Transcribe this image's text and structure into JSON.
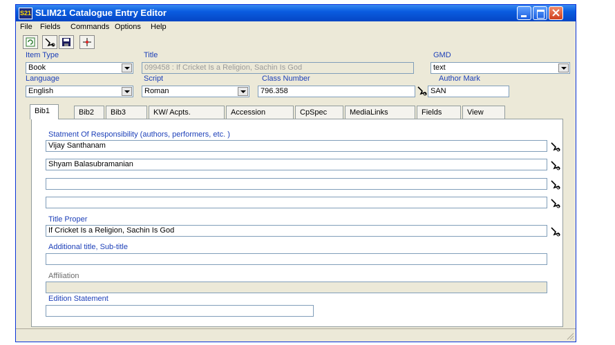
{
  "window": {
    "title": "SLIM21 Catalogue Entry Editor",
    "icon_text": "S21",
    "colors": {
      "titlebar": "#0a5ce0",
      "label": "#1c3fb8",
      "close_button": "#d0401e"
    }
  },
  "menubar": {
    "items": [
      "File",
      "Fields",
      "Commands",
      "Options",
      "Help"
    ]
  },
  "toolbar": {
    "icons": [
      "refresh-icon",
      "lookup-icon",
      "save-icon",
      "move-icon"
    ]
  },
  "header_fields": {
    "item_type": {
      "label": "Item Type",
      "value": "Book"
    },
    "title": {
      "label": "Title",
      "value": "099458 : If Cricket Is a Religion, Sachin Is God"
    },
    "gmd": {
      "label": "GMD",
      "value": "text"
    },
    "language": {
      "label": "Language",
      "value": "English"
    },
    "script": {
      "label": "Script",
      "value": "Roman"
    },
    "class_number": {
      "label": "Class Number",
      "value": "796.358"
    },
    "author_mark": {
      "label": "Author Mark",
      "value": "SAN"
    }
  },
  "tabs": [
    "Bib1",
    "Bib2",
    "Bib3",
    "KW/ Acpts.",
    "Accession",
    "CpSpec",
    "MediaLinks",
    "Fields",
    "View"
  ],
  "bib1": {
    "responsibility_label": "Statment Of Responsibility (authors, performers, etc. )",
    "responsibility_values": [
      "Vijay Santhanam",
      "Shyam Balasubramanian",
      "",
      ""
    ],
    "title_proper_label": "Title Proper",
    "title_proper_value": "If Cricket Is a Religion, Sachin Is God",
    "subtitle_label": "Additional title, Sub-title",
    "subtitle_value": "",
    "affiliation_label": "Affiliation",
    "affiliation_value": "",
    "edition_label": "Edition Statement",
    "edition_value": ""
  }
}
